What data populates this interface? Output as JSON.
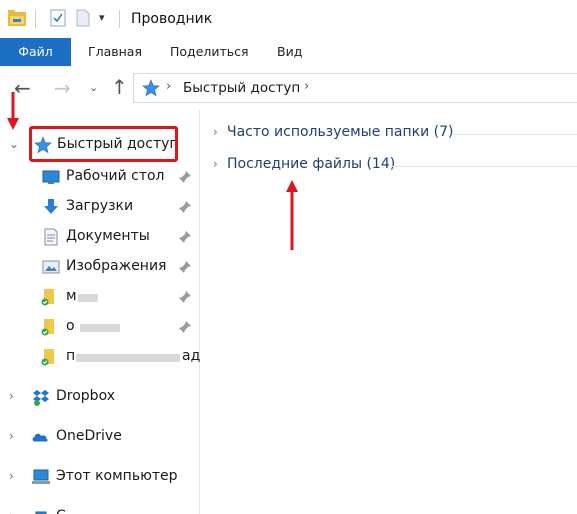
{
  "window": {
    "title": "Проводник"
  },
  "ribbon": {
    "tabs": [
      "Файл",
      "Главная",
      "Поделиться",
      "Вид"
    ]
  },
  "address": {
    "path_segment": "Быстрый доступ"
  },
  "nav_pane": {
    "quick_access": "Быстрый доступ",
    "pinned": [
      {
        "label": "Рабочий стол",
        "icon": "desktop-icon"
      },
      {
        "label": "Загрузки",
        "icon": "download-icon"
      },
      {
        "label": "Документы",
        "icon": "documents-icon"
      },
      {
        "label": "Изображения",
        "icon": "pictures-icon"
      },
      {
        "label": "м",
        "icon": "folder-synced-icon"
      },
      {
        "label": "о",
        "icon": "folder-synced-icon"
      },
      {
        "label": "п",
        "label_end": "ад",
        "icon": "folder-synced-icon"
      }
    ],
    "dropbox": "Dropbox",
    "onedrive": "OneDrive",
    "this_pc": "Этот компьютер",
    "network_partial": "С"
  },
  "content": {
    "groups": [
      {
        "label": "Часто используемые папки (7)"
      },
      {
        "label": "Последние файлы (14)"
      }
    ]
  },
  "colors": {
    "file_tab": "#1a6fc4",
    "annotation_red": "#e0141e",
    "group_text": "#1e3f7a"
  }
}
